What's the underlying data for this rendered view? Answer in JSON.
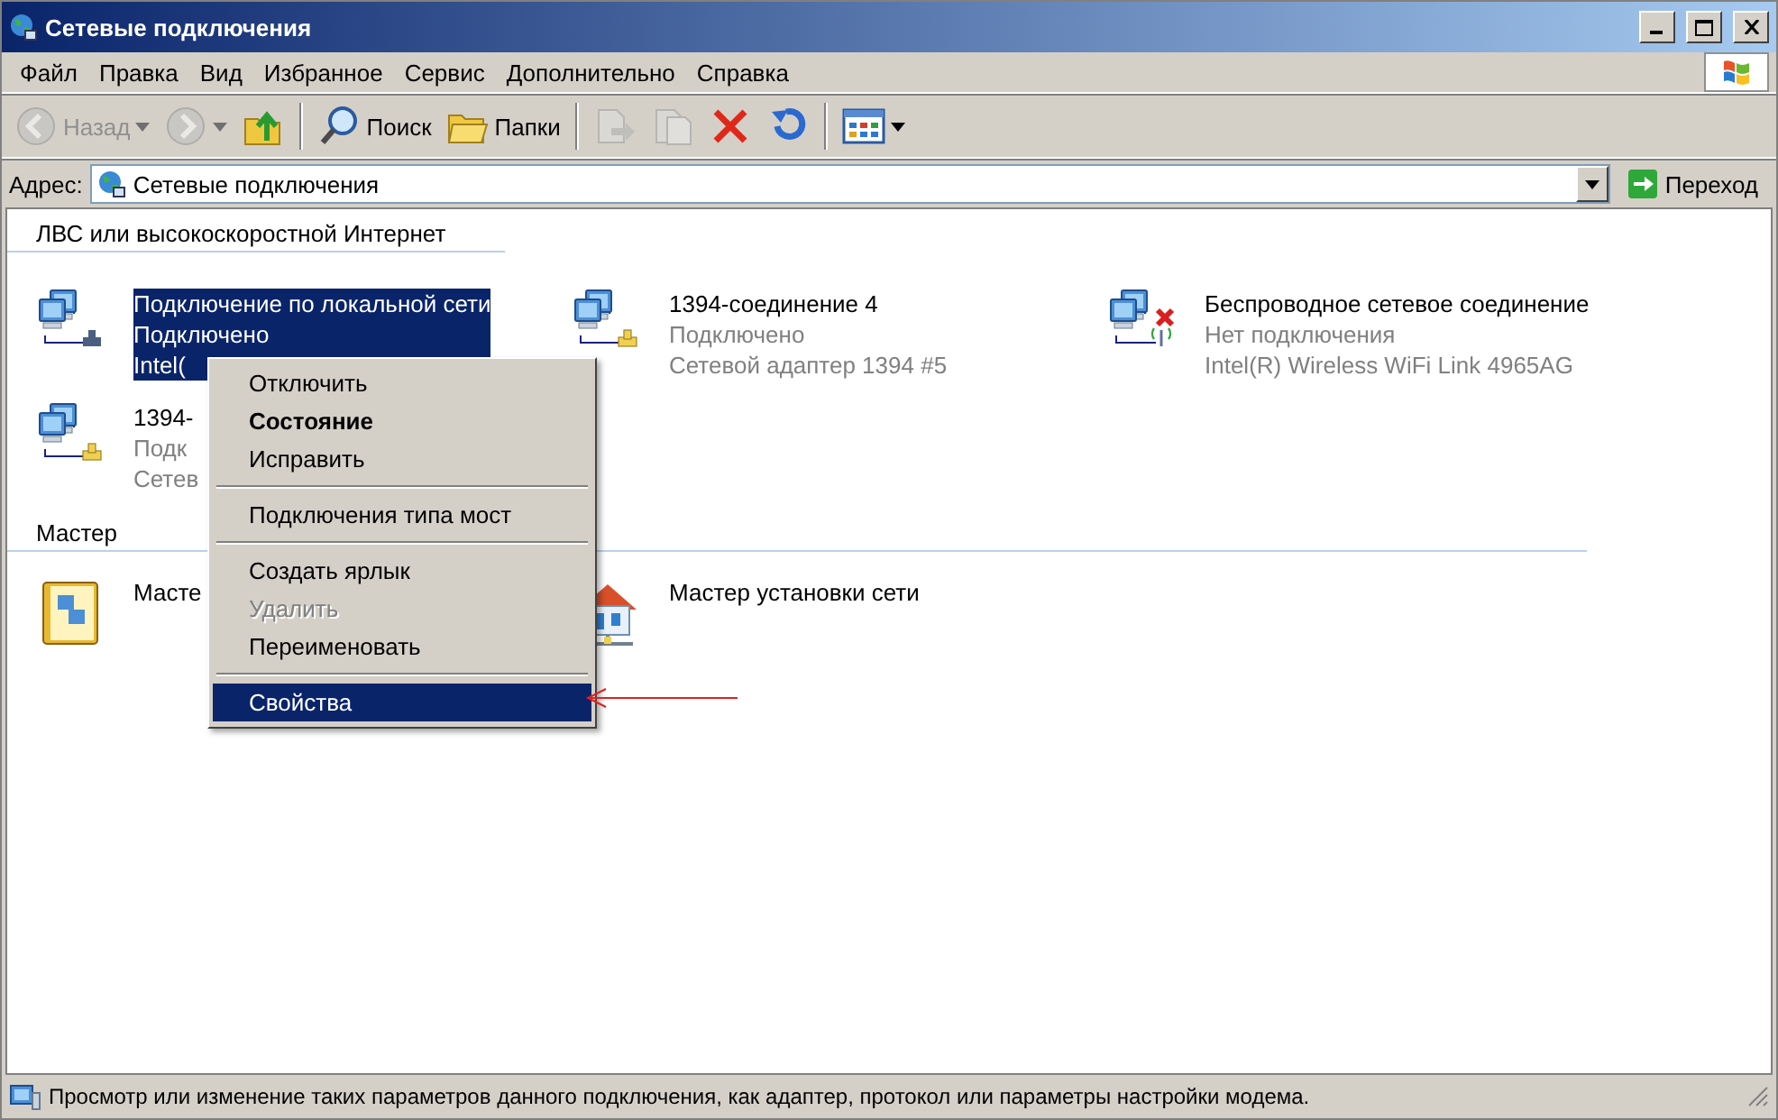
{
  "window": {
    "title": "Сетевые подключения"
  },
  "menu_bar": [
    "Файл",
    "Правка",
    "Вид",
    "Избранное",
    "Сервис",
    "Дополнительно",
    "Справка"
  ],
  "toolbar": [
    {
      "kind": "back",
      "label": "Назад",
      "disabled": true,
      "dropdown": true
    },
    {
      "kind": "forward",
      "disabled": true,
      "dropdown": true
    },
    {
      "kind": "up",
      "disabled": false
    },
    {
      "kind": "separator"
    },
    {
      "kind": "search",
      "label": "Поиск",
      "disabled": false
    },
    {
      "kind": "folders",
      "label": "Папки",
      "disabled": false
    },
    {
      "kind": "separator"
    },
    {
      "kind": "move",
      "disabled": true
    },
    {
      "kind": "copy",
      "disabled": true
    },
    {
      "kind": "delete",
      "disabled": false
    },
    {
      "kind": "undo",
      "disabled": false
    },
    {
      "kind": "separator"
    },
    {
      "kind": "views",
      "disabled": false,
      "dropdown": true
    }
  ],
  "address": {
    "label": "Адрес:",
    "value": "Сетевые подключения",
    "go": "Переход"
  },
  "sections": [
    {
      "title": "ЛВС или высокоскоростной Интернет",
      "items": [
        {
          "kind": "lan",
          "name": "Подключение по локальной сети",
          "status": "Подключено",
          "device": "Intel(",
          "connected": true,
          "selected": true
        },
        {
          "kind": "firewire",
          "name": "1394-соединение 4",
          "status": "Подключено",
          "device": "Сетевой адаптер 1394 #5",
          "connected": true,
          "selected": false
        },
        {
          "kind": "wireless",
          "name": "Беспроводное сетевое соединение",
          "status": "Нет подключения",
          "device": "Intel(R) Wireless WiFi Link 4965AG",
          "connected": false,
          "selected": false
        },
        {
          "kind": "firewire",
          "name": "1394-",
          "status": "Подк",
          "device": "Сетев",
          "connected": true,
          "selected": false
        }
      ]
    },
    {
      "title": "Мастер",
      "items": [
        {
          "kind": "wizard",
          "name": "Масте",
          "selected": false
        },
        {
          "kind": "home",
          "name": "Мастер установки сети",
          "selected": false
        }
      ]
    }
  ],
  "context_menu": [
    {
      "kind": "item",
      "label": "Отключить",
      "bold": false,
      "disabled": false,
      "selected": false
    },
    {
      "kind": "item",
      "label": "Состояние",
      "bold": true,
      "disabled": false,
      "selected": false
    },
    {
      "kind": "item",
      "label": "Исправить",
      "bold": false,
      "disabled": false,
      "selected": false
    },
    {
      "kind": "separator"
    },
    {
      "kind": "item",
      "label": "Подключения типа мост",
      "bold": false,
      "disabled": false,
      "selected": false
    },
    {
      "kind": "separator"
    },
    {
      "kind": "item",
      "label": "Создать ярлык",
      "bold": false,
      "disabled": false,
      "selected": false
    },
    {
      "kind": "item",
      "label": "Удалить",
      "bold": false,
      "disabled": true,
      "selected": false
    },
    {
      "kind": "item",
      "label": "Переименовать",
      "bold": false,
      "disabled": false,
      "selected": false
    },
    {
      "kind": "separator"
    },
    {
      "kind": "item",
      "label": "Свойства",
      "bold": false,
      "disabled": false,
      "selected": true
    }
  ],
  "status_bar": {
    "text": "Просмотр или изменение таких параметров данного подключения, как адаптер, протокол или параметры настройки модема."
  }
}
